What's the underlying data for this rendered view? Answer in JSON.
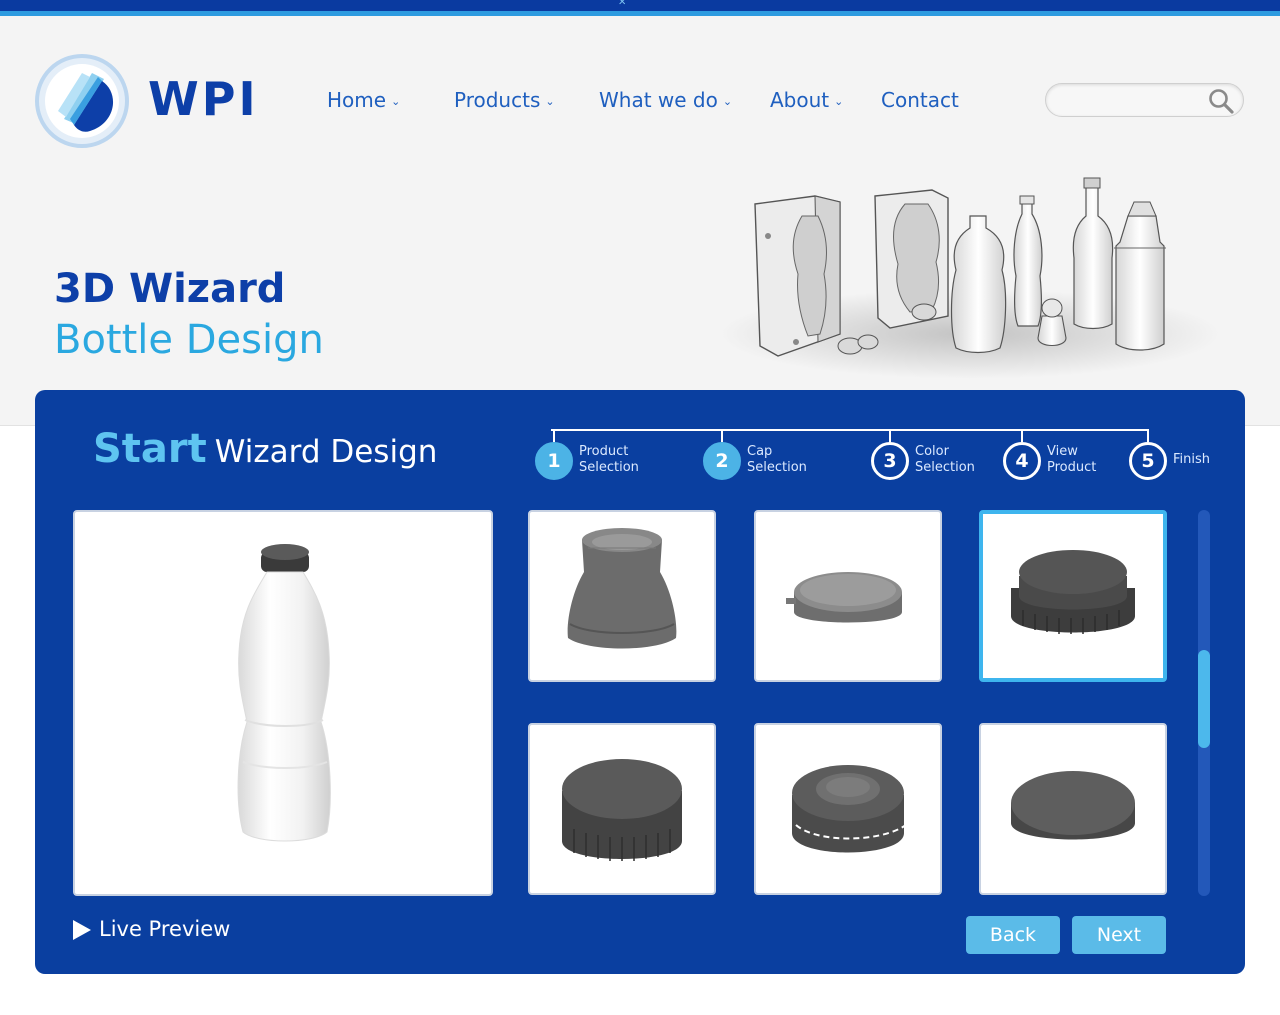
{
  "brand": {
    "name": "WPI"
  },
  "nav": {
    "items": [
      {
        "label": "Home",
        "has_dropdown": true
      },
      {
        "label": "Products",
        "has_dropdown": true
      },
      {
        "label": "What we do",
        "has_dropdown": true
      },
      {
        "label": "About",
        "has_dropdown": true
      },
      {
        "label": "Contact",
        "has_dropdown": false
      }
    ],
    "chevron": "⌄"
  },
  "search": {
    "value": "",
    "placeholder": "",
    "icon": "search-icon"
  },
  "hero": {
    "title_line1": "3D Wizard",
    "title_line2": "Bottle Design"
  },
  "wizard": {
    "title_strong": "Start",
    "title_rest": "Wizard Design",
    "steps": [
      {
        "number": "1",
        "label": "Product\nSelection",
        "status": "done"
      },
      {
        "number": "2",
        "label": "Cap\nSelection",
        "status": "done"
      },
      {
        "number": "3",
        "label": "Color\nSelection",
        "status": "todo"
      },
      {
        "number": "4",
        "label": "View\nProduct",
        "status": "todo"
      },
      {
        "number": "5",
        "label": "Finish",
        "status": "todo"
      }
    ],
    "caps": [
      {
        "type": "dropper-cap",
        "selected": false
      },
      {
        "type": "flat-disc-cap",
        "selected": false
      },
      {
        "type": "ribbed-screw-cap",
        "selected": true
      },
      {
        "type": "tall-ribbed-cap",
        "selected": false
      },
      {
        "type": "tamper-ring-cap",
        "selected": false
      },
      {
        "type": "smooth-disc-cap",
        "selected": false
      }
    ],
    "live_preview_label": "Live Preview",
    "back_label": "Back",
    "next_label": "Next"
  },
  "colors": {
    "brand_dark": "#0a3fa0",
    "brand_light": "#2aa8e0",
    "accent": "#5bbbe8",
    "step_done": "#4cb3e6"
  }
}
